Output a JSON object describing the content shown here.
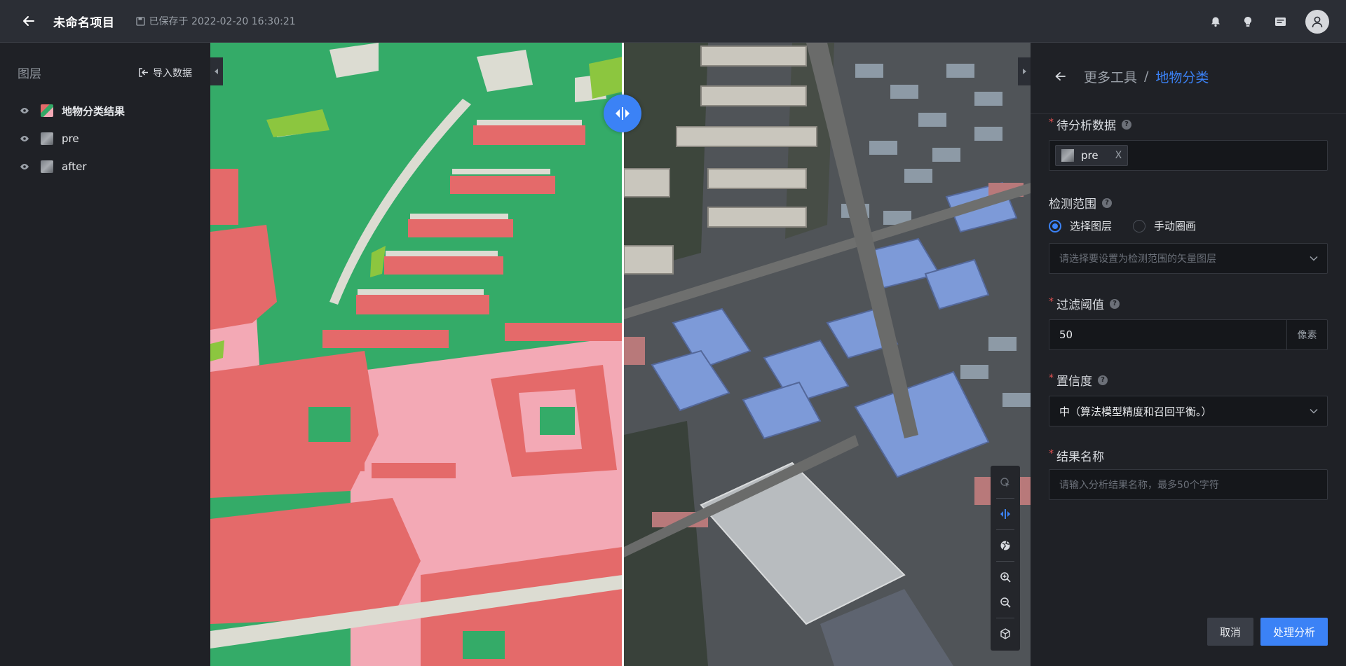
{
  "header": {
    "project_title": "未命名项目",
    "save_status": "已保存于 2022-02-20 16:30:21"
  },
  "layers": {
    "title": "图层",
    "import_label": "导入数据",
    "items": [
      {
        "name": "地物分类结果",
        "visible": true
      },
      {
        "name": "pre",
        "visible": true
      },
      {
        "name": "after",
        "visible": true
      }
    ]
  },
  "panel": {
    "breadcrumb_parent": "更多工具",
    "breadcrumb_sep": "/",
    "breadcrumb_current": "地物分类",
    "input_data": {
      "label": "待分析数据",
      "tag": "pre",
      "tag_close": "X"
    },
    "range": {
      "label": "检测范围",
      "option_layer": "选择图层",
      "option_draw": "手动圈画",
      "selected": "选择图层",
      "placeholder": "请选择要设置为检测范围的矢量图层"
    },
    "threshold": {
      "label": "过滤阈值",
      "value": "50",
      "unit": "像素"
    },
    "confidence": {
      "label": "置信度",
      "value": "中（算法模型精度和召回平衡。）"
    },
    "result_name": {
      "label": "结果名称",
      "placeholder": "请输入分析结果名称，最多50个字符"
    },
    "cancel_label": "取消",
    "submit_label": "处理分析"
  },
  "colors": {
    "accent": "#3b82f6",
    "class_vegetation": "#34ab68",
    "class_building": "#e46a6a",
    "class_bareland": "#f3a9b5",
    "class_road": "#dcdcd2",
    "class_grass": "#8cc63f"
  }
}
